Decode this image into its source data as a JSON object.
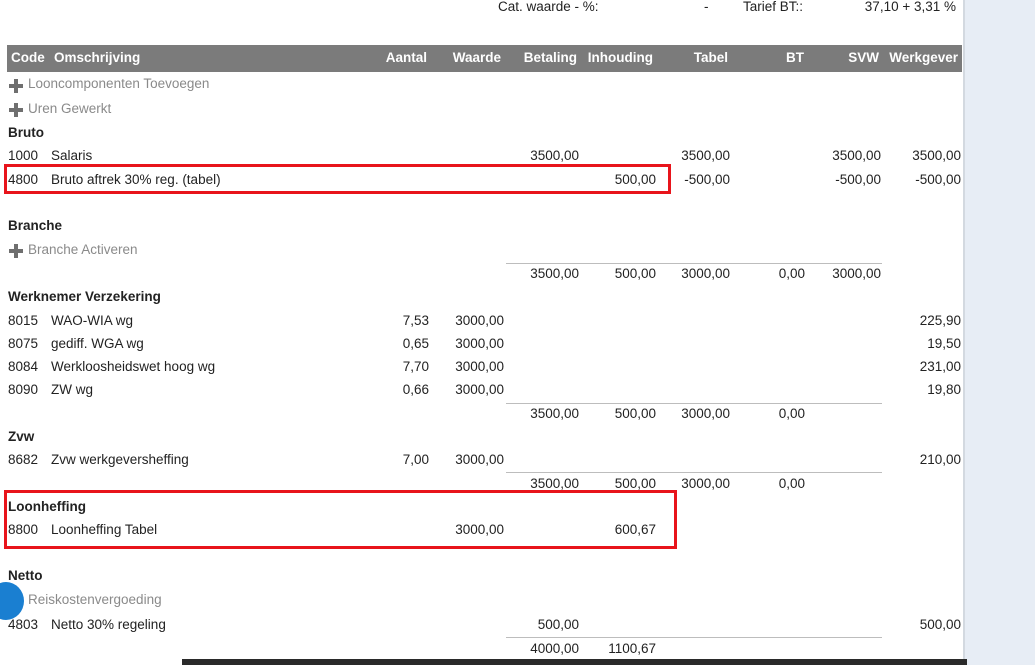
{
  "top_info": {
    "cat_label": "Cat. waarde - %:",
    "cat_value": "-",
    "tarief_label": "Tarief BT::",
    "tarief_value": "37,10 + 3,31 %"
  },
  "columns": {
    "code": "Code",
    "omschrijving": "Omschrijving",
    "aantal": "Aantal",
    "waarde": "Waarde",
    "betaling": "Betaling",
    "inhouding": "Inhouding",
    "tabel": "Tabel",
    "bt": "BT",
    "svw": "SVW",
    "werkgever": "Werkgever"
  },
  "actions": {
    "add_looncomponenten": "Looncomponenten Toevoegen",
    "uren_gewerkt": "Uren Gewerkt",
    "branche_activeren": "Branche Activeren",
    "reiskosten": "Reiskostenvergoeding"
  },
  "sections": {
    "bruto": "Bruto",
    "branche": "Branche",
    "werknemer": "Werknemer Verzekering",
    "zvw": "Zvw",
    "loonheffing": "Loonheffing",
    "netto": "Netto"
  },
  "rows": [
    {
      "code": "1000",
      "desc": "Salaris",
      "aantal": "",
      "waarde": "",
      "betaling": "3500,00",
      "inhouding": "",
      "tabel": "3500,00",
      "bt": "",
      "svw": "3500,00",
      "werkgever": "3500,00"
    },
    {
      "code": "4800",
      "desc": "Bruto aftrek 30% reg. (tabel)",
      "aantal": "",
      "waarde": "",
      "betaling": "",
      "inhouding": "500,00",
      "tabel": "-500,00",
      "bt": "",
      "svw": "-500,00",
      "werkgever": "-500,00"
    },
    {
      "code": "8015",
      "desc": "WAO-WIA wg",
      "aantal": "7,53",
      "waarde": "3000,00",
      "betaling": "",
      "inhouding": "",
      "tabel": "",
      "bt": "",
      "svw": "",
      "werkgever": "225,90"
    },
    {
      "code": "8075",
      "desc": "gediff. WGA wg",
      "aantal": "0,65",
      "waarde": "3000,00",
      "betaling": "",
      "inhouding": "",
      "tabel": "",
      "bt": "",
      "svw": "",
      "werkgever": "19,50"
    },
    {
      "code": "8084",
      "desc": "Werkloosheidswet hoog wg",
      "aantal": "7,70",
      "waarde": "3000,00",
      "betaling": "",
      "inhouding": "",
      "tabel": "",
      "bt": "",
      "svw": "",
      "werkgever": "231,00"
    },
    {
      "code": "8090",
      "desc": "ZW wg",
      "aantal": "0,66",
      "waarde": "3000,00",
      "betaling": "",
      "inhouding": "",
      "tabel": "",
      "bt": "",
      "svw": "",
      "werkgever": "19,80"
    },
    {
      "code": "8682",
      "desc": "Zvw werkgevers­heffing",
      "aantal": "7,00",
      "waarde": "3000,00",
      "betaling": "",
      "inhouding": "",
      "tabel": "",
      "bt": "",
      "svw": "",
      "werkgever": "210,00"
    },
    {
      "code": "8800",
      "desc": "Loonheffing Tabel",
      "aantal": "",
      "waarde": "3000,00",
      "betaling": "",
      "inhouding": "600,67",
      "tabel": "",
      "bt": "",
      "svw": "",
      "werkgever": ""
    },
    {
      "code": "4803",
      "desc": "Netto 30% regeling",
      "aantal": "",
      "waarde": "",
      "betaling": "500,00",
      "inhouding": "",
      "tabel": "",
      "bt": "",
      "svw": "",
      "werkgever": "500,00"
    }
  ],
  "subtotals": [
    {
      "betaling": "3500,00",
      "inhouding": "500,00",
      "tabel": "3000,00",
      "bt": "0,00",
      "svw": "3000,00"
    },
    {
      "betaling": "3500,00",
      "inhouding": "500,00",
      "tabel": "3000,00",
      "bt": "0,00",
      "svw": ""
    },
    {
      "betaling": "3500,00",
      "inhouding": "500,00",
      "tabel": "3000,00",
      "bt": "0,00",
      "svw": ""
    },
    {
      "betaling": "4000,00",
      "inhouding": "1100,67",
      "tabel": "",
      "bt": "",
      "svw": ""
    }
  ],
  "colors": {
    "header_bg": "#7b7b7b",
    "highlight": "#e8141b",
    "action_text": "#8a8a8a"
  }
}
